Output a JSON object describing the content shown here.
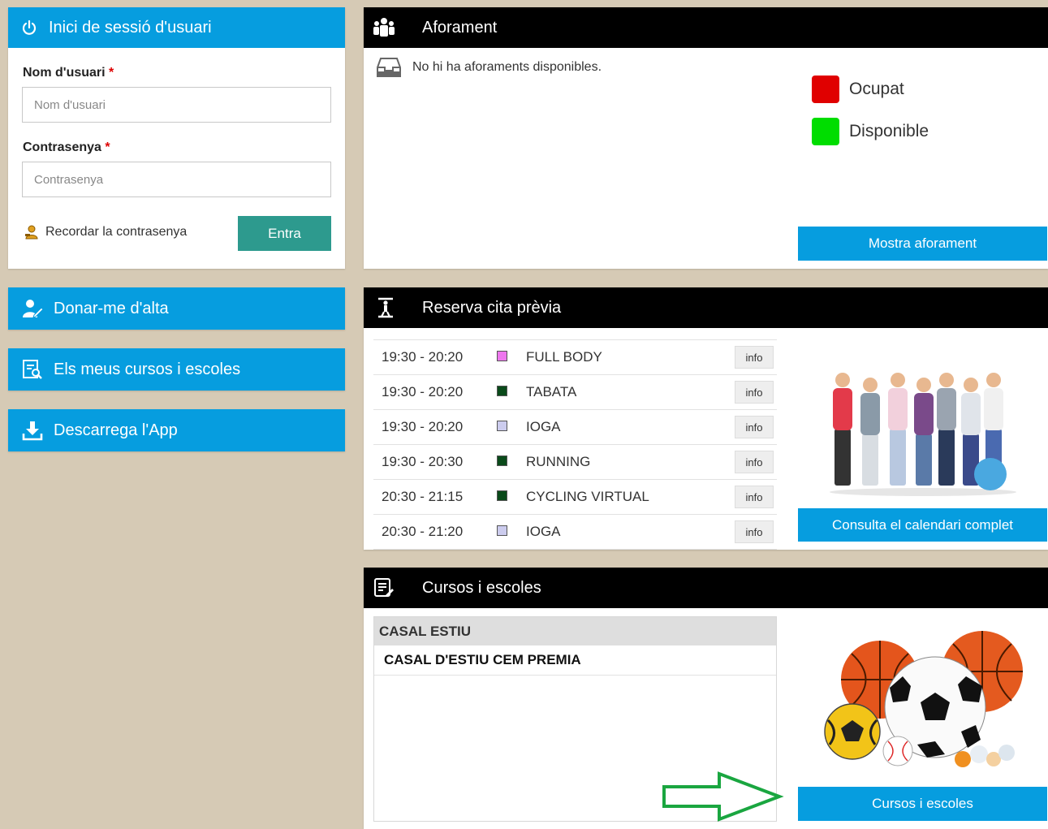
{
  "login": {
    "title": "Inici de sessió d'usuari",
    "username_label": "Nom d'usuari",
    "username_placeholder": "Nom d'usuari",
    "password_label": "Contrasenya",
    "password_placeholder": "Contrasenya",
    "required_mark": "*",
    "remember_label": "Recordar la contrasenya",
    "submit_label": "Entra"
  },
  "sidebar": {
    "items": [
      {
        "label": "Donar-me d'alta",
        "icon": "user-edit-icon"
      },
      {
        "label": "Els meus cursos i escoles",
        "icon": "course-search-icon"
      },
      {
        "label": "Descarrega l'App",
        "icon": "download-icon"
      }
    ]
  },
  "capacity": {
    "title": "Aforament",
    "empty_message": "No hi ha aforaments disponibles.",
    "legend": [
      {
        "label": "Ocupat",
        "color": "#e00000"
      },
      {
        "label": "Disponible",
        "color": "#00dd00"
      }
    ],
    "button_label": "Mostra aforament"
  },
  "booking": {
    "title": "Reserva cita prèvia",
    "rows": [
      {
        "time": "19:30 - 20:20",
        "color": "#ee77ee",
        "activity": "FULL BODY",
        "info": "info"
      },
      {
        "time": "19:30 - 20:20",
        "color": "#0a4a1a",
        "activity": "TABATA",
        "info": "info"
      },
      {
        "time": "19:30 - 20:20",
        "color": "#ccccee",
        "activity": "IOGA",
        "info": "info"
      },
      {
        "time": "19:30 - 20:30",
        "color": "#0a4a1a",
        "activity": "RUNNING",
        "info": "info"
      },
      {
        "time": "20:30 - 21:15",
        "color": "#0a4a1a",
        "activity": "CYCLING VIRTUAL",
        "info": "info"
      },
      {
        "time": "20:30 - 21:20",
        "color": "#ccccee",
        "activity": "IOGA",
        "info": "info"
      }
    ],
    "button_label": "Consulta el calendari complet"
  },
  "courses": {
    "title": "Cursos i escoles",
    "group_header": "CASAL ESTIU",
    "items": [
      "CASAL D'ESTIU CEM PREMIA"
    ],
    "button_label": "Cursos i escoles"
  },
  "colors": {
    "accent_blue": "#069ddf",
    "teal": "#2d9a8e",
    "background": "#d6cab5",
    "arrow_green": "#1aa640"
  }
}
